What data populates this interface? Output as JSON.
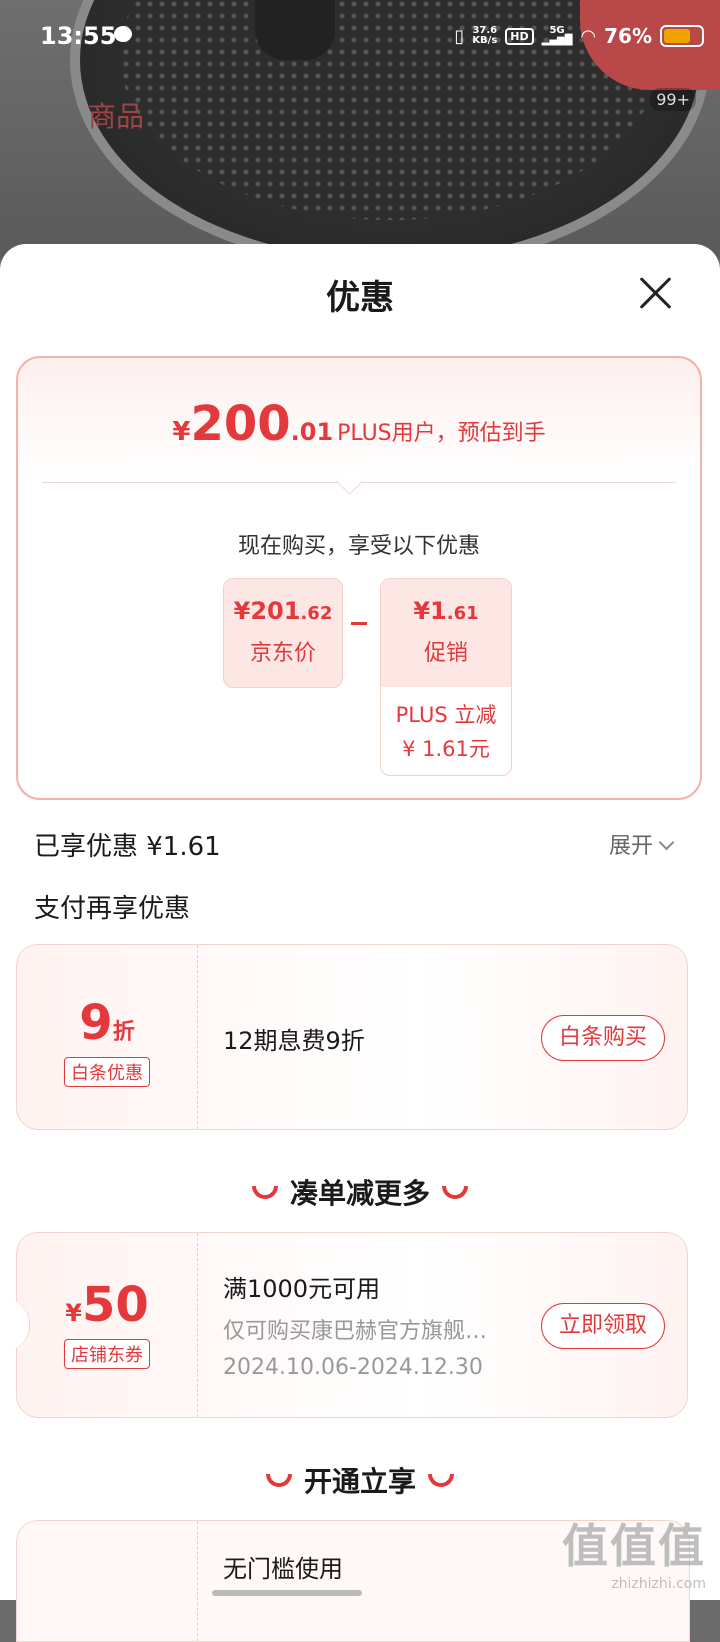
{
  "status_bar": {
    "time": "13:55",
    "net_speed": "37.6",
    "net_unit": "KB/s",
    "hd": "HD",
    "signal": "5G",
    "battery": "76%"
  },
  "background": {
    "tab_label": "商品",
    "cart_count": "99+"
  },
  "sheet": {
    "title": "优惠"
  },
  "price_card": {
    "currency": "¥",
    "price_int": "200",
    "price_dec": ".01",
    "est_text": "PLUS用户，预估到手",
    "buy_now_text": "现在购买，享受以下优惠",
    "jd_price_yen": "¥",
    "jd_price_int": "201",
    "jd_price_dec": ".62",
    "jd_price_label": "京东价",
    "minus_sign": "-",
    "promo_yen": "¥",
    "promo_int": "1",
    "promo_dec": ".61",
    "promo_label": "促销",
    "promo_detail_1": "PLUS 立减",
    "promo_detail_2": "¥ 1.61元"
  },
  "enjoyed": {
    "label": "已享优惠 ¥1.61",
    "expand_label": "展开"
  },
  "pay_more": {
    "label": "支付再享优惠"
  },
  "baitiao_coupon": {
    "value": "9",
    "unit": "折",
    "tag": "白条优惠",
    "desc": "12期息费9折",
    "button": "白条购买"
  },
  "section_combine": {
    "title": "凑单减更多"
  },
  "shop_coupon": {
    "yen": "¥",
    "value": "50",
    "tag": "店铺东券",
    "title": "满1000元可用",
    "sub": "仅可购买康巴赫官方旗舰…",
    "date": "2024.10.06-2024.12.30",
    "button": "立即领取"
  },
  "section_open": {
    "title": "开通立享"
  },
  "partial_card": {
    "title": "无门槛使用"
  },
  "watermark": {
    "logo": "值值值",
    "url": "zhizhizhi.com"
  },
  "colors": {
    "accent": "#e4393c",
    "card_border": "#f3b2aa",
    "card_bg": "#fde7e4"
  }
}
